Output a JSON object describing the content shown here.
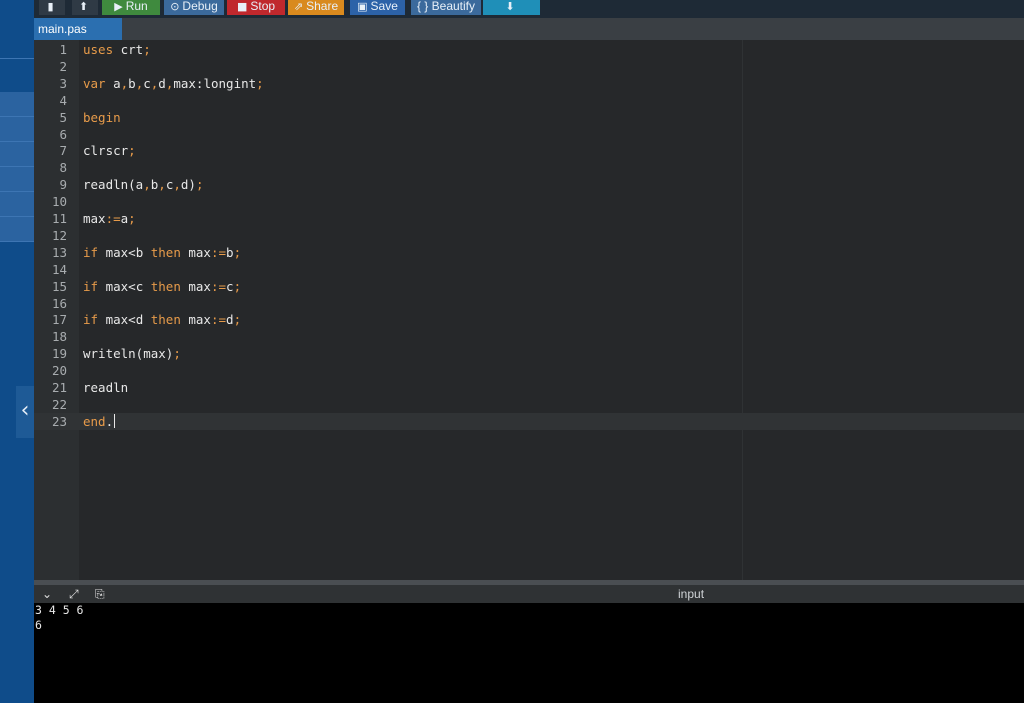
{
  "toolbar": {
    "buttons": [
      {
        "icon": "file-icon",
        "glyph": "▮",
        "label": "",
        "color": "#2f3a45"
      },
      {
        "icon": "upload-icon",
        "glyph": "⬆",
        "label": "",
        "color": "#2f3a45"
      },
      {
        "icon": "play-icon",
        "glyph": "▶",
        "label": "Run",
        "color": "#3f8a3e"
      },
      {
        "icon": "debug-icon",
        "glyph": "⊙",
        "label": "Debug",
        "color": "#3b6a9c"
      },
      {
        "icon": "stop-icon",
        "glyph": "■",
        "label": "Stop",
        "color": "#c0282d"
      },
      {
        "icon": "share-icon",
        "glyph": "⇗",
        "label": "Share",
        "color": "#d98a1e"
      },
      {
        "icon": "save-icon",
        "glyph": "▣",
        "label": "Save",
        "color": "#2c62a8"
      },
      {
        "icon": "beautify-icon",
        "glyph": "",
        "label": "{ } Beautify",
        "color": "#3b6a9c"
      },
      {
        "icon": "download-icon",
        "glyph": "⬇",
        "label": "",
        "color": "#1f8fb8"
      }
    ]
  },
  "tab": {
    "label": "main.pas"
  },
  "editor": {
    "lines": [
      {
        "n": "1",
        "tokens": [
          {
            "t": "uses",
            "c": "kw"
          },
          {
            "t": " crt"
          },
          {
            "t": ";",
            "c": "pn"
          }
        ]
      },
      {
        "n": "2",
        "tokens": []
      },
      {
        "n": "3",
        "tokens": [
          {
            "t": "var",
            "c": "kw"
          },
          {
            "t": " a"
          },
          {
            "t": ",",
            "c": "pn"
          },
          {
            "t": "b"
          },
          {
            "t": ",",
            "c": "pn"
          },
          {
            "t": "c"
          },
          {
            "t": ",",
            "c": "pn"
          },
          {
            "t": "d"
          },
          {
            "t": ",",
            "c": "pn"
          },
          {
            "t": "max:longint"
          },
          {
            "t": ";",
            "c": "pn"
          }
        ]
      },
      {
        "n": "4",
        "tokens": []
      },
      {
        "n": "5",
        "tokens": [
          {
            "t": "begin",
            "c": "kw"
          }
        ]
      },
      {
        "n": "6",
        "tokens": []
      },
      {
        "n": "7",
        "tokens": [
          {
            "t": "clrscr"
          },
          {
            "t": ";",
            "c": "pn"
          }
        ]
      },
      {
        "n": "8",
        "tokens": []
      },
      {
        "n": "9",
        "tokens": [
          {
            "t": "readln(a"
          },
          {
            "t": ",",
            "c": "pn"
          },
          {
            "t": "b"
          },
          {
            "t": ",",
            "c": "pn"
          },
          {
            "t": "c"
          },
          {
            "t": ",",
            "c": "pn"
          },
          {
            "t": "d)"
          },
          {
            "t": ";",
            "c": "pn"
          }
        ]
      },
      {
        "n": "10",
        "tokens": []
      },
      {
        "n": "11",
        "tokens": [
          {
            "t": "max"
          },
          {
            "t": ":=",
            "c": "pn"
          },
          {
            "t": "a"
          },
          {
            "t": ";",
            "c": "pn"
          }
        ]
      },
      {
        "n": "12",
        "tokens": []
      },
      {
        "n": "13",
        "tokens": [
          {
            "t": "if",
            "c": "kw"
          },
          {
            "t": " max<b "
          },
          {
            "t": "then",
            "c": "kw"
          },
          {
            "t": " max"
          },
          {
            "t": ":=",
            "c": "pn"
          },
          {
            "t": "b"
          },
          {
            "t": ";",
            "c": "pn"
          }
        ]
      },
      {
        "n": "14",
        "tokens": []
      },
      {
        "n": "15",
        "tokens": [
          {
            "t": "if",
            "c": "kw"
          },
          {
            "t": " max<c "
          },
          {
            "t": "then",
            "c": "kw"
          },
          {
            "t": " max"
          },
          {
            "t": ":=",
            "c": "pn"
          },
          {
            "t": "c"
          },
          {
            "t": ";",
            "c": "pn"
          }
        ]
      },
      {
        "n": "16",
        "tokens": []
      },
      {
        "n": "17",
        "tokens": [
          {
            "t": "if",
            "c": "kw"
          },
          {
            "t": " max<d "
          },
          {
            "t": "then",
            "c": "kw"
          },
          {
            "t": " max"
          },
          {
            "t": ":=",
            "c": "pn"
          },
          {
            "t": "d"
          },
          {
            "t": ";",
            "c": "pn"
          }
        ]
      },
      {
        "n": "18",
        "tokens": []
      },
      {
        "n": "19",
        "tokens": [
          {
            "t": "writeln(max)"
          },
          {
            "t": ";",
            "c": "pn"
          }
        ]
      },
      {
        "n": "20",
        "tokens": []
      },
      {
        "n": "21",
        "tokens": [
          {
            "t": "readln"
          }
        ]
      },
      {
        "n": "22",
        "tokens": []
      },
      {
        "n": "23",
        "tokens": [
          {
            "t": "end",
            "c": "kw"
          },
          {
            "t": "."
          }
        ],
        "active": true
      }
    ]
  },
  "output": {
    "label": "input",
    "icons": [
      "chevron-down-icon",
      "expand-icon",
      "clipboard-icon"
    ],
    "console_lines": [
      "3 4 5 6",
      "6"
    ]
  }
}
